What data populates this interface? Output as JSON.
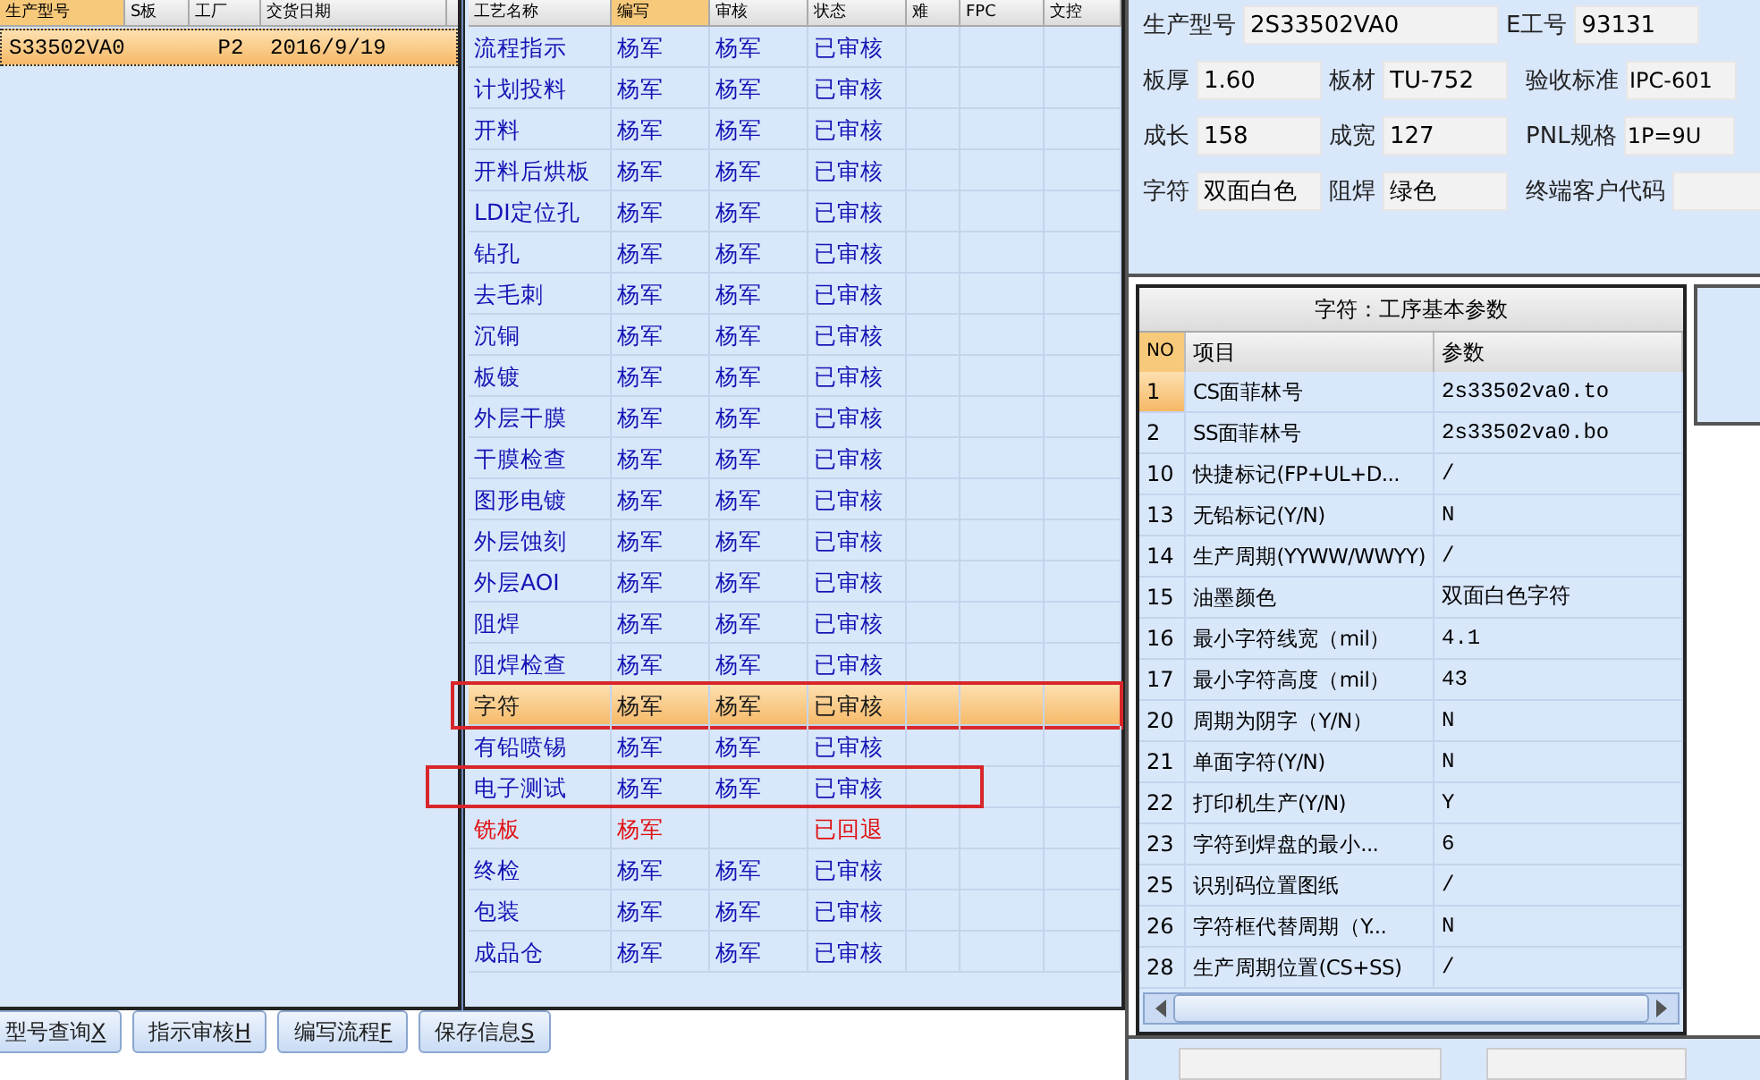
{
  "models": {
    "columns": [
      "生产型号",
      "S板",
      "工厂",
      "交货日期"
    ],
    "rows": [
      {
        "model": "S33502VA0",
        "factory": "P2",
        "date": "2016/9/19",
        "selected": true
      }
    ]
  },
  "process": {
    "columns": [
      "工艺名称",
      "编写",
      "审核",
      "状态",
      "难",
      "FPC",
      "文控"
    ],
    "rows": [
      {
        "name": "流程指示",
        "writer": "杨军",
        "reviewer": "杨军",
        "status": "已审核",
        "returned": false,
        "selected": false,
        "annotated": false
      },
      {
        "name": "计划投料",
        "writer": "杨军",
        "reviewer": "杨军",
        "status": "已审核",
        "returned": false,
        "selected": false,
        "annotated": false
      },
      {
        "name": "开料",
        "writer": "杨军",
        "reviewer": "杨军",
        "status": "已审核",
        "returned": false,
        "selected": false,
        "annotated": false
      },
      {
        "name": "开料后烘板",
        "writer": "杨军",
        "reviewer": "杨军",
        "status": "已审核",
        "returned": false,
        "selected": false,
        "annotated": false
      },
      {
        "name": "LDI定位孔",
        "writer": "杨军",
        "reviewer": "杨军",
        "status": "已审核",
        "returned": false,
        "selected": false,
        "annotated": false
      },
      {
        "name": "钻孔",
        "writer": "杨军",
        "reviewer": "杨军",
        "status": "已审核",
        "returned": false,
        "selected": false,
        "annotated": false
      },
      {
        "name": "去毛刺",
        "writer": "杨军",
        "reviewer": "杨军",
        "status": "已审核",
        "returned": false,
        "selected": false,
        "annotated": false
      },
      {
        "name": "沉铜",
        "writer": "杨军",
        "reviewer": "杨军",
        "status": "已审核",
        "returned": false,
        "selected": false,
        "annotated": false
      },
      {
        "name": "板镀",
        "writer": "杨军",
        "reviewer": "杨军",
        "status": "已审核",
        "returned": false,
        "selected": false,
        "annotated": false
      },
      {
        "name": "外层干膜",
        "writer": "杨军",
        "reviewer": "杨军",
        "status": "已审核",
        "returned": false,
        "selected": false,
        "annotated": false
      },
      {
        "name": "干膜检查",
        "writer": "杨军",
        "reviewer": "杨军",
        "status": "已审核",
        "returned": false,
        "selected": false,
        "annotated": false
      },
      {
        "name": "图形电镀",
        "writer": "杨军",
        "reviewer": "杨军",
        "status": "已审核",
        "returned": false,
        "selected": false,
        "annotated": false
      },
      {
        "name": "外层蚀刻",
        "writer": "杨军",
        "reviewer": "杨军",
        "status": "已审核",
        "returned": false,
        "selected": false,
        "annotated": false
      },
      {
        "name": "外层AOI",
        "writer": "杨军",
        "reviewer": "杨军",
        "status": "已审核",
        "returned": false,
        "selected": false,
        "annotated": false
      },
      {
        "name": "阻焊",
        "writer": "杨军",
        "reviewer": "杨军",
        "status": "已审核",
        "returned": false,
        "selected": false,
        "annotated": false
      },
      {
        "name": "阻焊检查",
        "writer": "杨军",
        "reviewer": "杨军",
        "status": "已审核",
        "returned": false,
        "selected": false,
        "annotated": false
      },
      {
        "name": "字符",
        "writer": "杨军",
        "reviewer": "杨军",
        "status": "已审核",
        "returned": false,
        "selected": true,
        "annotated": true
      },
      {
        "name": "有铅喷锡",
        "writer": "杨军",
        "reviewer": "杨军",
        "status": "已审核",
        "returned": false,
        "selected": false,
        "annotated": false
      },
      {
        "name": "电子测试",
        "writer": "杨军",
        "reviewer": "杨军",
        "status": "已审核",
        "returned": false,
        "selected": false,
        "annotated": true
      },
      {
        "name": "铣板",
        "writer": "杨军",
        "status": "已回退",
        "returned": true,
        "selected": false,
        "annotated": false
      },
      {
        "name": "终检",
        "writer": "杨军",
        "reviewer": "杨军",
        "status": "已审核",
        "returned": false,
        "selected": false,
        "annotated": false
      },
      {
        "name": "包装",
        "writer": "杨军",
        "reviewer": "杨军",
        "status": "已审核",
        "returned": false,
        "selected": false,
        "annotated": false
      },
      {
        "name": "成品仓",
        "writer": "杨军",
        "reviewer": "杨军",
        "status": "已审核",
        "returned": false,
        "selected": false,
        "annotated": false
      }
    ]
  },
  "info": [
    [
      {
        "label": "生产型号",
        "value": "2S33502VA0"
      },
      {
        "label": "E工号",
        "value": "93131"
      }
    ],
    [
      {
        "label": "板厚",
        "value": "1.60"
      },
      {
        "label": "板材",
        "value": "TU-752"
      },
      {
        "label": "验收标准",
        "value": "IPC-601"
      }
    ],
    [
      {
        "label": "成长",
        "value": "158"
      },
      {
        "label": "成宽",
        "value": "127"
      },
      {
        "label": "PNL规格",
        "value": "1P=9U"
      }
    ],
    [
      {
        "label": "字符",
        "value": "双面白色"
      },
      {
        "label": "阻焊",
        "value": "绿色"
      },
      {
        "label": "终端客户代码"
      }
    ]
  ],
  "params": {
    "title": "字符：工序基本参数",
    "columns": [
      "NO",
      "项目",
      "参数"
    ],
    "rows": [
      {
        "no": "1",
        "item": "CS面菲林号",
        "value": "2s33502va0.to",
        "selected": true
      },
      {
        "no": "2",
        "item": "SS面菲林号",
        "value": "2s33502va0.bo",
        "selected": false
      },
      {
        "no": "10",
        "item": "快捷标记(FP+UL+D...",
        "value": "/",
        "selected": false
      },
      {
        "no": "13",
        "item": "无铅标记(Y/N)",
        "value": "N",
        "selected": false
      },
      {
        "no": "14",
        "item": "生产周期(YYWW/WWYY)",
        "value": "/",
        "selected": false
      },
      {
        "no": "15",
        "item": "油墨颜色",
        "value": "双面白色字符",
        "selected": false
      },
      {
        "no": "16",
        "item": "最小字符线宽（mil）",
        "value": "4.1",
        "selected": false
      },
      {
        "no": "17",
        "item": "最小字符高度（mil）",
        "value": "43",
        "selected": false
      },
      {
        "no": "20",
        "item": "周期为阴字（Y/N）",
        "value": "N",
        "selected": false
      },
      {
        "no": "21",
        "item": "单面字符(Y/N)",
        "value": "N",
        "selected": false
      },
      {
        "no": "22",
        "item": "打印机生产(Y/N)",
        "value": "Y",
        "selected": false
      },
      {
        "no": "23",
        "item": "字符到焊盘的最小...",
        "value": "6",
        "selected": false
      },
      {
        "no": "25",
        "item": "识别码位置图纸",
        "value": "/",
        "selected": false
      },
      {
        "no": "26",
        "item": "字符框代替周期（Y...",
        "value": "N",
        "selected": false
      },
      {
        "no": "28",
        "item": "生产周期位置(CS+SS)",
        "value": "/",
        "selected": false
      }
    ]
  },
  "buttons": [
    {
      "label": "型号查询",
      "key": "X"
    },
    {
      "label": "指示审核",
      "key": "H"
    },
    {
      "label": "编写流程",
      "key": "F"
    },
    {
      "label": "保存信息",
      "key": "S"
    }
  ]
}
